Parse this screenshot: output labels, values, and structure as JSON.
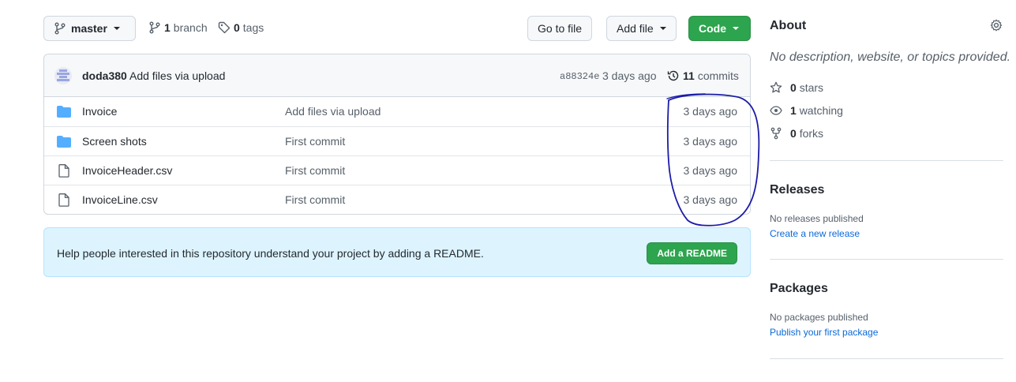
{
  "toolbar": {
    "branch_label": "master",
    "branches_count": "1",
    "branches_label": "branch",
    "tags_count": "0",
    "tags_label": "tags",
    "go_to_file": "Go to file",
    "add_file": "Add file",
    "code": "Code"
  },
  "latest_commit": {
    "author": "doda380",
    "message": "Add files via upload",
    "sha": "a88324e",
    "time": "3 days ago",
    "commits_count": "11",
    "commits_label": "commits"
  },
  "files": [
    {
      "type": "folder",
      "name": "Invoice",
      "message": "Add files via upload",
      "age": "3 days ago"
    },
    {
      "type": "folder",
      "name": "Screen shots",
      "message": "First commit",
      "age": "3 days ago"
    },
    {
      "type": "file",
      "name": "InvoiceHeader.csv",
      "message": "First commit",
      "age": "3 days ago"
    },
    {
      "type": "file",
      "name": "InvoiceLine.csv",
      "message": "First commit",
      "age": "3 days ago"
    }
  ],
  "readme_banner": {
    "text": "Help people interested in this repository understand your project by adding a README.",
    "button": "Add a README"
  },
  "about": {
    "title": "About",
    "description": "No description, website, or topics provided.",
    "stars_count": "0",
    "stars_label": "stars",
    "watching_count": "1",
    "watching_label": "watching",
    "forks_count": "0",
    "forks_label": "forks"
  },
  "releases": {
    "title": "Releases",
    "empty": "No releases published",
    "link": "Create a new release"
  },
  "packages": {
    "title": "Packages",
    "empty": "No packages published",
    "link": "Publish your first package"
  },
  "colors": {
    "accent_green": "#2da44e",
    "link_blue": "#0969da",
    "folder_blue": "#54aeff",
    "annotation_ink": "#1c1ca8"
  },
  "icons": [
    "branch-icon",
    "tag-icon",
    "history-icon",
    "folder-icon",
    "file-icon",
    "gear-icon",
    "star-icon",
    "eye-icon",
    "fork-icon"
  ]
}
